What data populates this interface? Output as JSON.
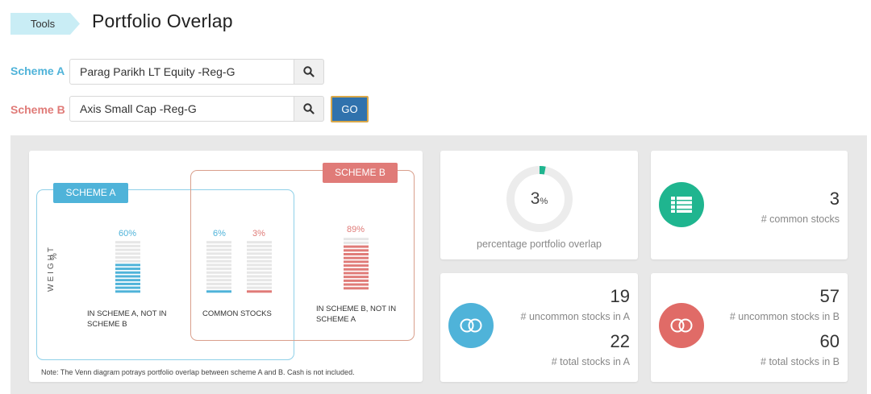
{
  "header": {
    "breadcrumb": "Tools",
    "title": "Portfolio Overlap"
  },
  "scheme_a": {
    "label": "Scheme A",
    "value": "Parag Parikh LT Equity -Reg-G"
  },
  "scheme_b": {
    "label": "Scheme B",
    "value": "Axis Small Cap -Reg-G"
  },
  "go_label": "GO",
  "venn": {
    "tag_a": "SCHEME A",
    "tag_b": "SCHEME B",
    "y_axis_unit": "%",
    "y_axis_label": "WEIGHT",
    "only_a": {
      "pct_label": "60%",
      "value": 60,
      "caption": "IN SCHEME A, NOT IN SCHEME B"
    },
    "common_a": {
      "pct_label": "6%",
      "value": 6
    },
    "common_b": {
      "pct_label": "3%",
      "value": 3
    },
    "common_caption": "COMMON STOCKS",
    "only_b": {
      "pct_label": "89%",
      "value": 89,
      "caption": "IN SCHEME B, NOT IN SCHEME A"
    },
    "note": "Note: The Venn diagram potrays portfolio overlap between scheme A and B. Cash is not included."
  },
  "overlap": {
    "value": "3",
    "unit": "%",
    "percent": 3,
    "label": "percentage portfolio overlap"
  },
  "common_stocks": {
    "value": "3",
    "label": "# common stocks"
  },
  "scheme_a_stats": {
    "uncommon_value": "19",
    "uncommon_label": "# uncommon stocks in A",
    "total_value": "22",
    "total_label": "# total stocks in A"
  },
  "scheme_b_stats": {
    "uncommon_value": "57",
    "uncommon_label": "# uncommon stocks in B",
    "total_value": "60",
    "total_label": "# total stocks in B"
  },
  "colors": {
    "scheme_a": "#4fb3d9",
    "scheme_b": "#e07b78",
    "teal": "#1fb58f",
    "go_button": "#3072ad",
    "bar_empty": "#e6e6e6"
  },
  "icons": {
    "common": "list-icon",
    "scheme_a": "toggle-circles-icon",
    "scheme_b": "toggle-circles-icon",
    "search": "search-icon"
  }
}
